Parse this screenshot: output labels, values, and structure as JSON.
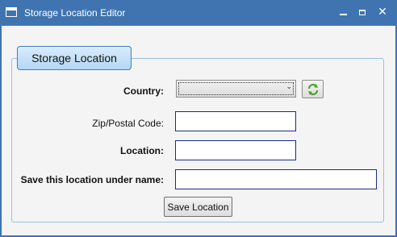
{
  "window": {
    "title": "Storage Location Editor",
    "controls": {
      "minimize": "minimize",
      "maximize": "maximize",
      "close": "close"
    }
  },
  "group": {
    "header": "Storage Location"
  },
  "form": {
    "country_label": "Country:",
    "country_value": "",
    "zip_label": "Zip/Postal Code:",
    "zip_value": "",
    "location_label": "Location:",
    "location_value": "",
    "save_name_label": "Save this location under name:",
    "save_name_value": "",
    "save_button": "Save Location"
  },
  "icons": {
    "app": "window-icon",
    "refresh": "refresh-icon",
    "dropdown": "chevron-down-icon"
  },
  "colors": {
    "titlebar": "#3f74b0",
    "header_border": "#3f7fbf",
    "input_border": "#1a2a8a",
    "group_border": "#93c3e0",
    "refresh_icon": "#4aa02c"
  }
}
